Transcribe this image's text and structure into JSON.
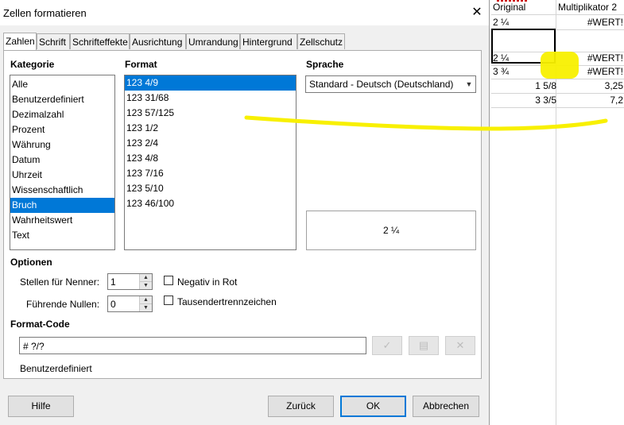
{
  "window": {
    "title": "Zellen formatieren",
    "close_glyph": "✕"
  },
  "tabs": [
    {
      "label": "Zahlen",
      "active": true
    },
    {
      "label": "Schrift"
    },
    {
      "label": "Schrifteffekte"
    },
    {
      "label": "Ausrichtung"
    },
    {
      "label": "Umrandung"
    },
    {
      "label": "Hintergrund"
    },
    {
      "label": "Zellschutz"
    }
  ],
  "category": {
    "header": "Kategorie",
    "items": [
      "Alle",
      "Benutzerdefiniert",
      "Dezimalzahl",
      "Prozent",
      "Währung",
      "Datum",
      "Uhrzeit",
      "Wissenschaftlich",
      "Bruch",
      "Wahrheitswert",
      "Text"
    ],
    "selected": "Bruch"
  },
  "format": {
    "header": "Format",
    "items": [
      "123 4/9",
      "123 31/68",
      "123  57/125",
      "123 1/2",
      "123 2/4",
      "123 4/8",
      "123  7/16",
      "123  5/10",
      "123 46/100"
    ],
    "selected": "123 4/9"
  },
  "language": {
    "header": "Sprache",
    "value": "Standard - Deutsch (Deutschland)"
  },
  "preview": {
    "value": "2 ¼"
  },
  "options": {
    "header": "Optionen",
    "denominator_label": "Stellen für Nenner:",
    "denominator_value": "1",
    "leading_zeros_label": "Führende Nullen:",
    "leading_zeros_value": "0",
    "negative_red_label": "Negativ in Rot",
    "negative_red_checked": false,
    "thousands_label": "Tausendertrennzeichen",
    "thousands_checked": false
  },
  "format_code": {
    "header": "Format-Code",
    "value": "# ?/?",
    "description": "Benutzerdefiniert"
  },
  "buttons": {
    "help": "Hilfe",
    "back": "Zurück",
    "ok": "OK",
    "cancel": "Abbrechen"
  },
  "spreadsheet": {
    "header_a": "Original",
    "header_b": "Multiplikator 2",
    "rows": [
      {
        "a": "2 ¼",
        "b": "#WERT!"
      },
      {
        "a": "",
        "b": ""
      },
      {
        "a": "2 ¼",
        "b": "#WERT!"
      },
      {
        "a": "3 ¾",
        "b": "#WERT!"
      },
      {
        "a": "1 5/8",
        "b": "3,25"
      },
      {
        "a": "3 3/5",
        "b": "7,2"
      }
    ]
  },
  "colors": {
    "selection": "#0078d7",
    "highlight": "#f8f000"
  }
}
